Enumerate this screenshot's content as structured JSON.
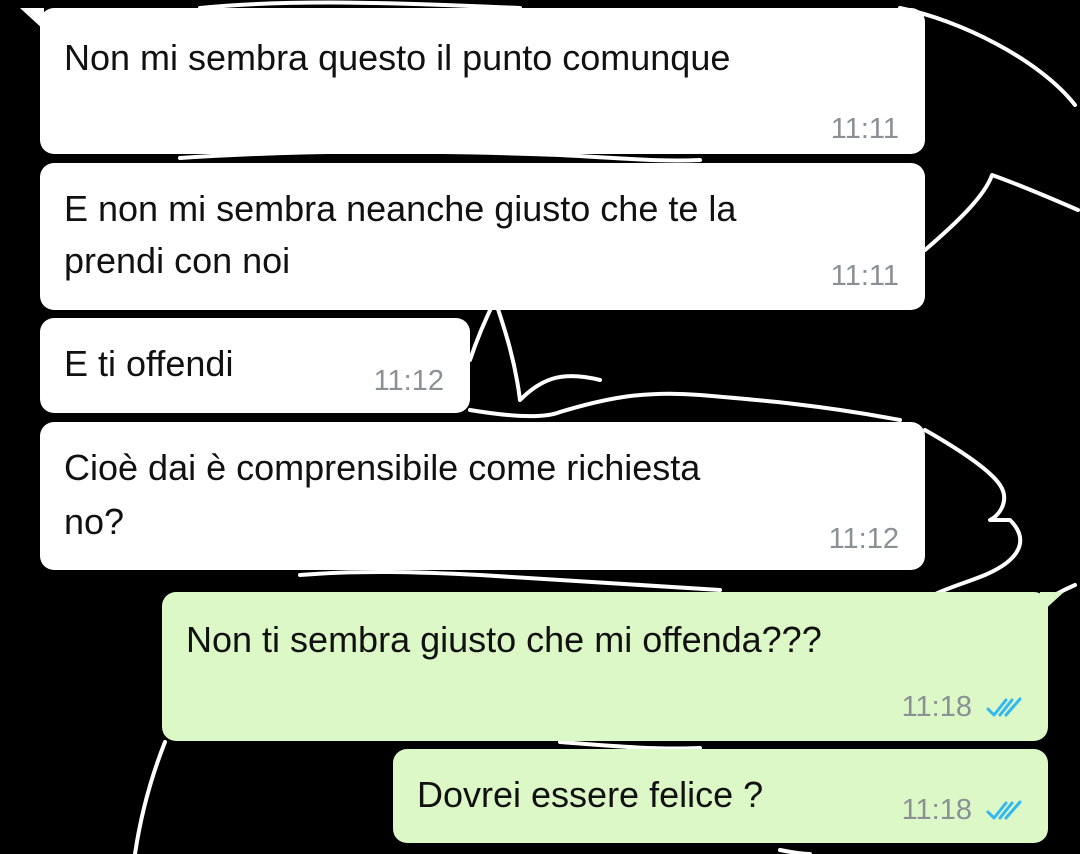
{
  "messages": [
    {
      "direction": "incoming",
      "lines": [
        "Non mi sembra questo il punto comunque"
      ],
      "time": "11:11"
    },
    {
      "direction": "incoming",
      "lines": [
        "E non mi sembra neanche giusto che te la",
        "prendi con noi"
      ],
      "time": "11:11"
    },
    {
      "direction": "incoming",
      "lines": [
        "E ti offendi"
      ],
      "time": "11:12"
    },
    {
      "direction": "incoming",
      "lines": [
        "Cioè dai è comprensibile come richiesta",
        "no?"
      ],
      "time": "11:12"
    },
    {
      "direction": "outgoing",
      "lines": [
        "Non ti sembra giusto che mi offenda???"
      ],
      "time": "11:18",
      "status": "read-double-check-icon"
    },
    {
      "direction": "outgoing",
      "lines": [
        "Dovrei essere felice ?"
      ],
      "time": "11:18",
      "status": "read-double-check-icon"
    }
  ],
  "colors": {
    "background": "#000000",
    "incoming_bubble": "#ffffff",
    "outgoing_bubble": "#dcf8c6",
    "timestamp": "#8a9094",
    "read_tick": "#34b7f1",
    "wallpaper_doodle": "#ffffff"
  }
}
